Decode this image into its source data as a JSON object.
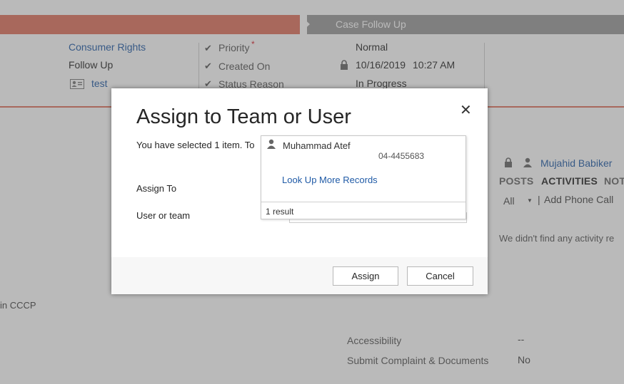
{
  "page": {
    "stage_label": "Case Follow Up",
    "left_fields": {
      "category": "Consumer Rights",
      "subcategory": "Follow Up",
      "customer": "test"
    },
    "mid_fields": {
      "priority_label": "Priority",
      "priority_required": "*",
      "created_on_label": "Created On",
      "status_reason_label": "Status Reason"
    },
    "mid_values": {
      "priority": "Normal",
      "created_date": "10/16/2019",
      "created_time": "10:27 AM",
      "status_reason": "In Progress"
    },
    "owner": "Mujahid Babiker",
    "tabs": [
      "POSTS",
      "ACTIVITIES",
      "NOT"
    ],
    "activity_filter": "All",
    "activity_separator": "|",
    "add_phone_call": "Add Phone Call",
    "empty_message": "We didn't find any activity re",
    "side_text": "in CCCP",
    "bottom_rows": [
      {
        "label": "Accessibility",
        "value": "--"
      },
      {
        "label": "Submit Complaint & Documents",
        "value": "No"
      }
    ]
  },
  "dialog": {
    "title": "Assign to Team or User",
    "selected_text": "You have selected 1 item. To",
    "assign_to_label": "Assign To",
    "user_or_team_label": "User or team",
    "lookup": {
      "result_name": "Muhammad Atef",
      "result_phone": "04-4455683",
      "more_records": "Look Up More Records",
      "result_count": "1 result"
    },
    "assign_button": "Assign",
    "cancel_button": "Cancel",
    "close_glyph": "✕"
  },
  "colors": {
    "accent": "#e0735e",
    "stage_gray": "#9a9a9a",
    "link": "#1f5aa6"
  }
}
